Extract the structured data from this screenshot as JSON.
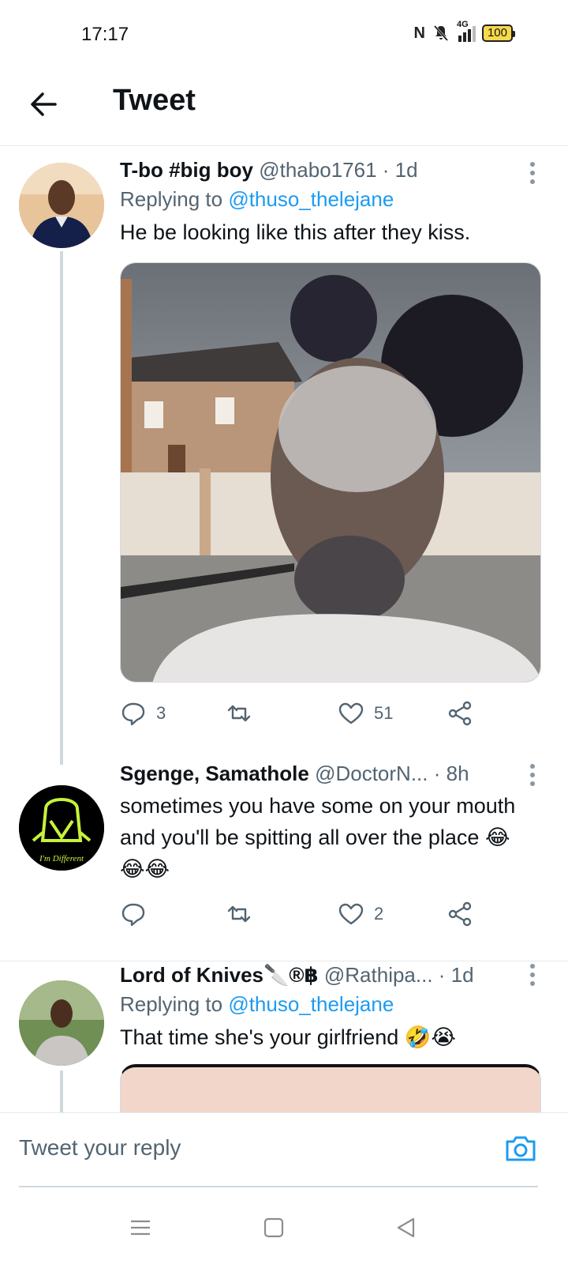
{
  "status_bar": {
    "time": "17:17",
    "nfc_icon": "N",
    "mute_icon": "bell-off",
    "network": "4G",
    "battery": "100"
  },
  "header": {
    "title": "Tweet"
  },
  "tweets": [
    {
      "name": "T-bo #big boy",
      "handle": "@thabo1761",
      "separator": "·",
      "time": "1d",
      "replying_prefix": "Replying to",
      "replying_to": "@thuso_thelejane",
      "text": "He be looking like this after they kiss.",
      "replies": "3",
      "retweets": "",
      "likes": "51"
    },
    {
      "name": "Sgenge, Samathole",
      "handle": "@DoctorN...",
      "separator": "·",
      "time": "8h",
      "text": "sometimes you have some on your mouth and you'll be spitting all over the place 😂😂😂",
      "replies": "",
      "retweets": "",
      "likes": "2"
    },
    {
      "name": "Lord of Knives🔪®฿",
      "handle": "@Rathipa...",
      "separator": "·",
      "time": "1d",
      "replying_prefix": "Replying to",
      "replying_to": "@thuso_thelejane",
      "text": "That time she's your girlfriend 🤣😭"
    }
  ],
  "reply_bar": {
    "placeholder": "Tweet your reply"
  },
  "colors": {
    "accent": "#1d9bf0",
    "secondary_text": "#536471",
    "primary_text": "#0f1419",
    "thread_line": "#cfd9de"
  }
}
